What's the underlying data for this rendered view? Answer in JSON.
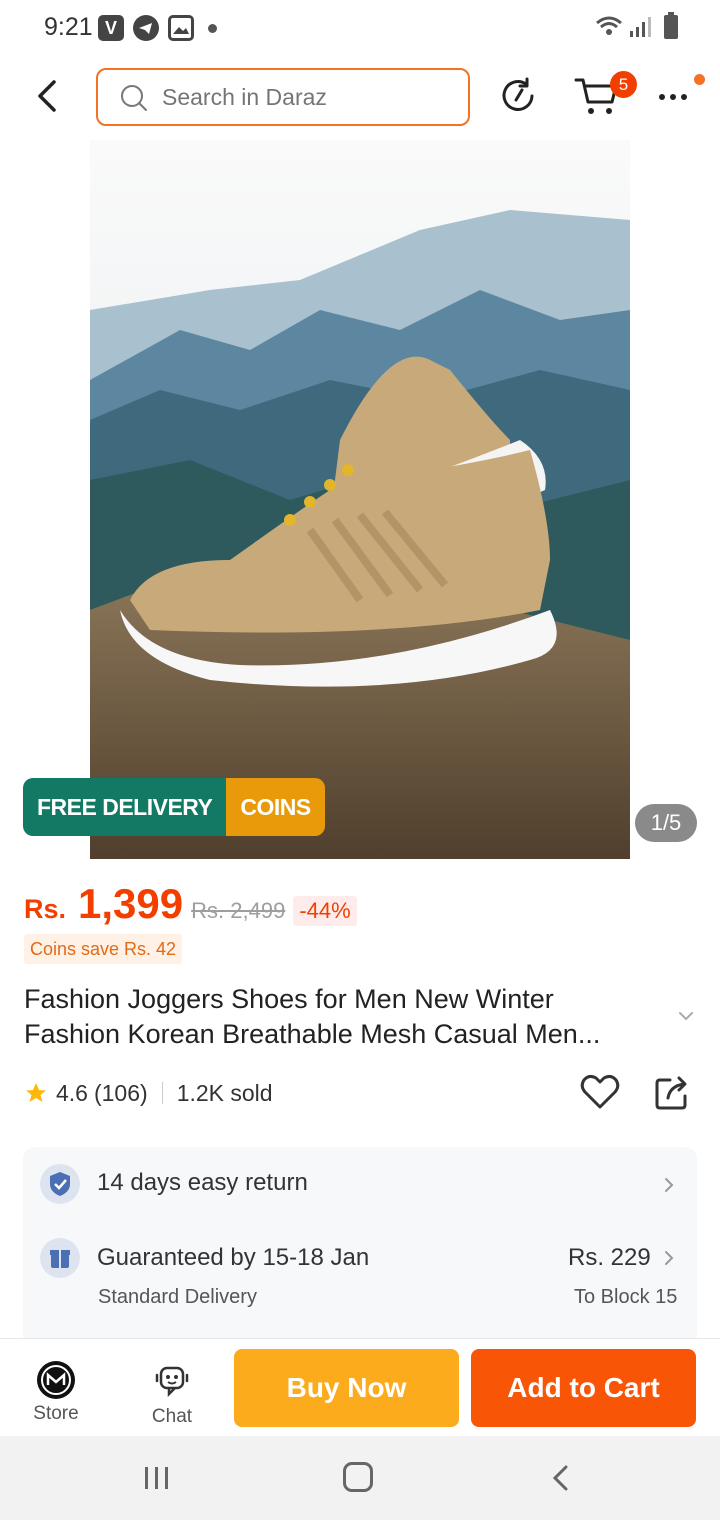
{
  "status_bar": {
    "time": "9:21",
    "v_icon_letter": "V"
  },
  "header": {
    "search_placeholder": "Search in Daraz",
    "cart_count": "5"
  },
  "product": {
    "image_counter": "1/5",
    "promo_free_delivery": "FREE DELIVERY",
    "promo_coins": "COINS",
    "price_currency": "Rs.",
    "price": "1,399",
    "original_price": "Rs. 2,499",
    "discount": "-44%",
    "coins_save": "Coins save Rs. 42",
    "title_line1": "Fashion Joggers Shoes for Men  New Winter",
    "title_line2": "Fashion Korean Breathable Mesh Casual Men...",
    "rating": "4.6",
    "review_count": "(106)",
    "sold": "1.2K sold"
  },
  "delivery": {
    "return_label": "14 days easy return",
    "guarantee_label": "Guaranteed by 15-18 Jan",
    "delivery_type": "Standard Delivery",
    "delivery_fee": "Rs. 229",
    "delivery_location": "To Block 15"
  },
  "actions": {
    "store_label": "Store",
    "chat_label": "Chat",
    "buy_now": "Buy Now",
    "add_to_cart": "Add to Cart"
  },
  "colors": {
    "brand_orange": "#f85606",
    "buy_yellow": "#fbab1c",
    "price_red": "#f23f00",
    "delivery_green": "#127a64",
    "coins_gold": "#e89a0b"
  }
}
